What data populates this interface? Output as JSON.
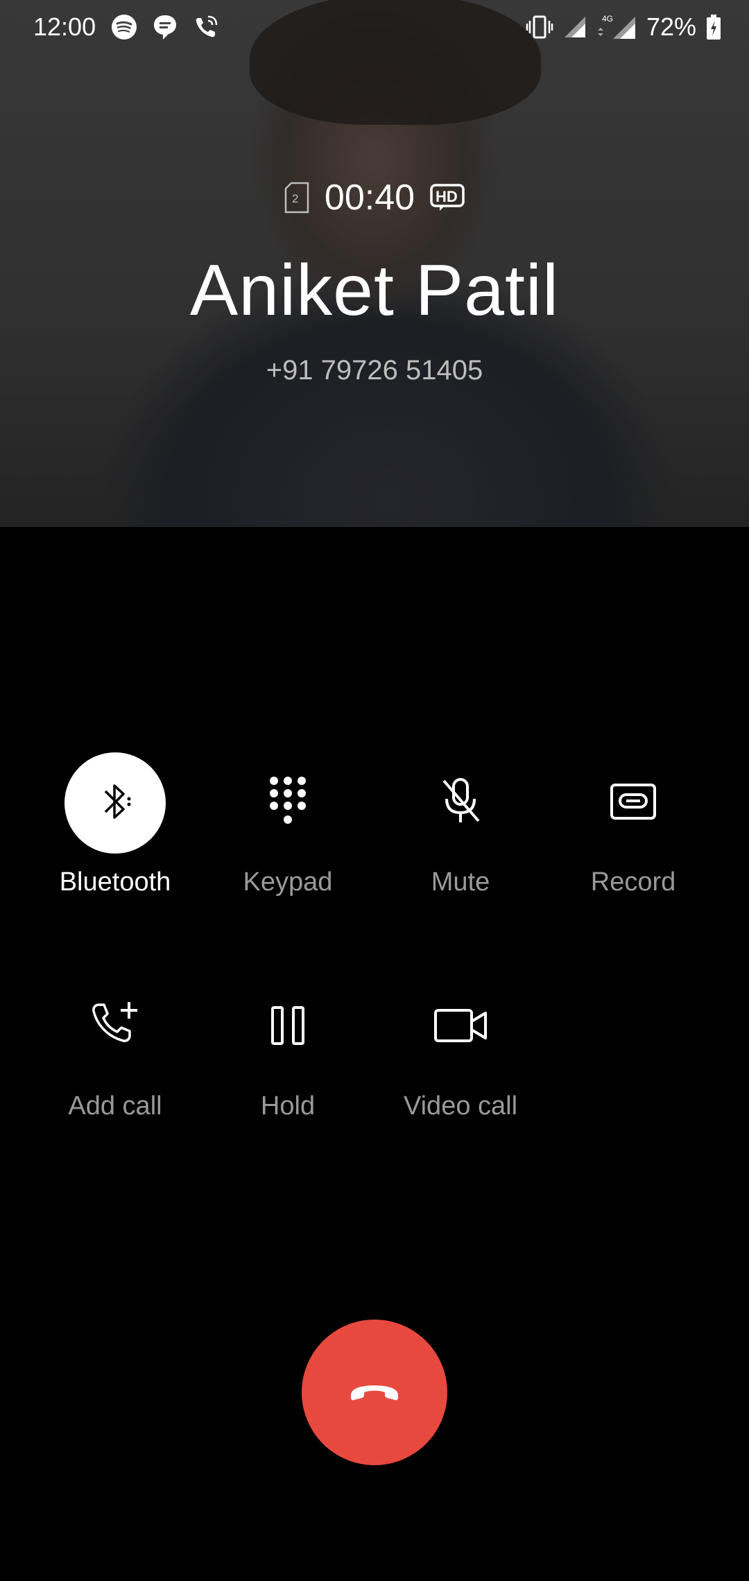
{
  "status_bar": {
    "time": "12:00",
    "network_type": "4G",
    "battery_percent": "72%"
  },
  "call": {
    "sim_slot": "2",
    "timer": "00:40",
    "hd_label": "HD",
    "caller_name": "Aniket Patil",
    "caller_number": "+91 79726 51405"
  },
  "controls": {
    "bluetooth": "Bluetooth",
    "keypad": "Keypad",
    "mute": "Mute",
    "record": "Record",
    "add_call": "Add call",
    "hold": "Hold",
    "video_call": "Video call"
  },
  "colors": {
    "end_call": "#e8493f",
    "active_button": "#ffffff",
    "inactive_label": "#9a9a9a"
  },
  "icons": {
    "bluetooth": "bluetooth-icon",
    "keypad": "dialpad-icon",
    "mute": "mic-off-icon",
    "record": "record-tape-icon",
    "add_call": "add-call-icon",
    "hold": "pause-icon",
    "video_call": "video-camera-icon",
    "end_call": "phone-hangup-icon"
  }
}
